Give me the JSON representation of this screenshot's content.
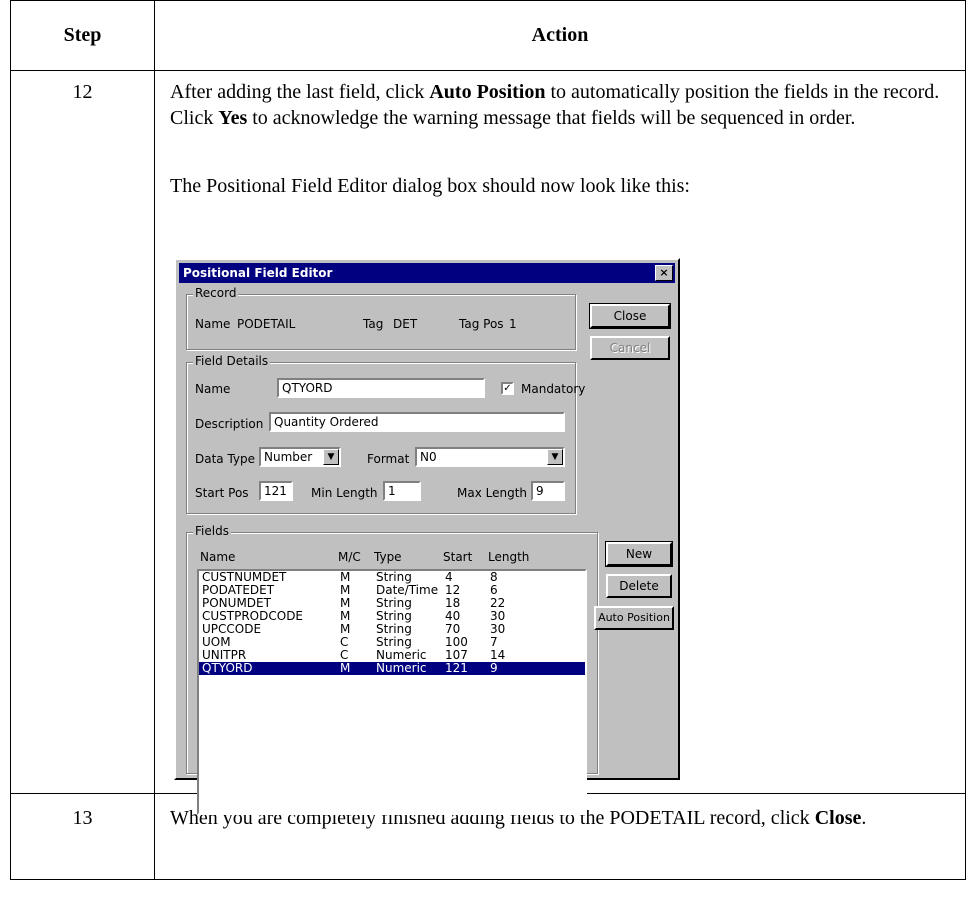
{
  "table": {
    "header_step": "Step",
    "header_action": "Action",
    "row12": {
      "step": "12",
      "para1_pre": "After adding the last field, click ",
      "para1_b1": "Auto Position",
      "para1_mid": " to automatically position the fields in the record. Click ",
      "para1_b2": "Yes",
      "para1_post": " to acknowledge the warning message that fields will be sequenced in order.",
      "para2": "The Positional Field Editor dialog box should now look like this:"
    },
    "row13": {
      "step": "13",
      "text_pre": "When you are completely finished adding fields to the PODETAIL record, click ",
      "text_bold": "Close",
      "text_post": "."
    }
  },
  "dialog": {
    "title": "Positional Field Editor",
    "close_x": "×",
    "record": {
      "group_label": "Record",
      "name_label": "Name",
      "name_value": "PODETAIL",
      "tag_label": "Tag",
      "tag_value": "DET",
      "tagpos_label": "Tag Pos",
      "tagpos_value": "1"
    },
    "buttons": {
      "close": "Close",
      "cancel": "Cancel",
      "new": "New",
      "delete": "Delete",
      "auto_position": "Auto Position"
    },
    "field_details": {
      "group_label": "Field Details",
      "name_label": "Name",
      "name_value": "QTYORD",
      "mandatory_label": "Mandatory",
      "mandatory_checked": true,
      "description_label": "Description",
      "description_value": "Quantity Ordered",
      "datatype_label": "Data Type",
      "datatype_value": "Number",
      "format_label": "Format",
      "format_value": "N0",
      "startpos_label": "Start Pos",
      "startpos_value": "121",
      "minlen_label": "Min Length",
      "minlen_value": "1",
      "maxlen_label": "Max Length",
      "maxlen_value": "9"
    },
    "fields": {
      "group_label": "Fields",
      "columns": [
        "Name",
        "M/C",
        "Type",
        "Start",
        "Length"
      ],
      "rows": [
        [
          "CUSTNUMDET",
          "M",
          "String",
          "4",
          "8"
        ],
        [
          "PODATEDET",
          "M",
          "Date/Time",
          "12",
          "6"
        ],
        [
          "PONUMDET",
          "M",
          "String",
          "18",
          "22"
        ],
        [
          "CUSTPRODCODE",
          "M",
          "String",
          "40",
          "30"
        ],
        [
          "UPCCODE",
          "M",
          "String",
          "70",
          "30"
        ],
        [
          "UOM",
          "C",
          "String",
          "100",
          "7"
        ],
        [
          "UNITPR",
          "C",
          "Numeric",
          "107",
          "14"
        ],
        [
          "QTYORD",
          "M",
          "Numeric",
          "121",
          "9"
        ]
      ],
      "selected_index": 7
    }
  }
}
